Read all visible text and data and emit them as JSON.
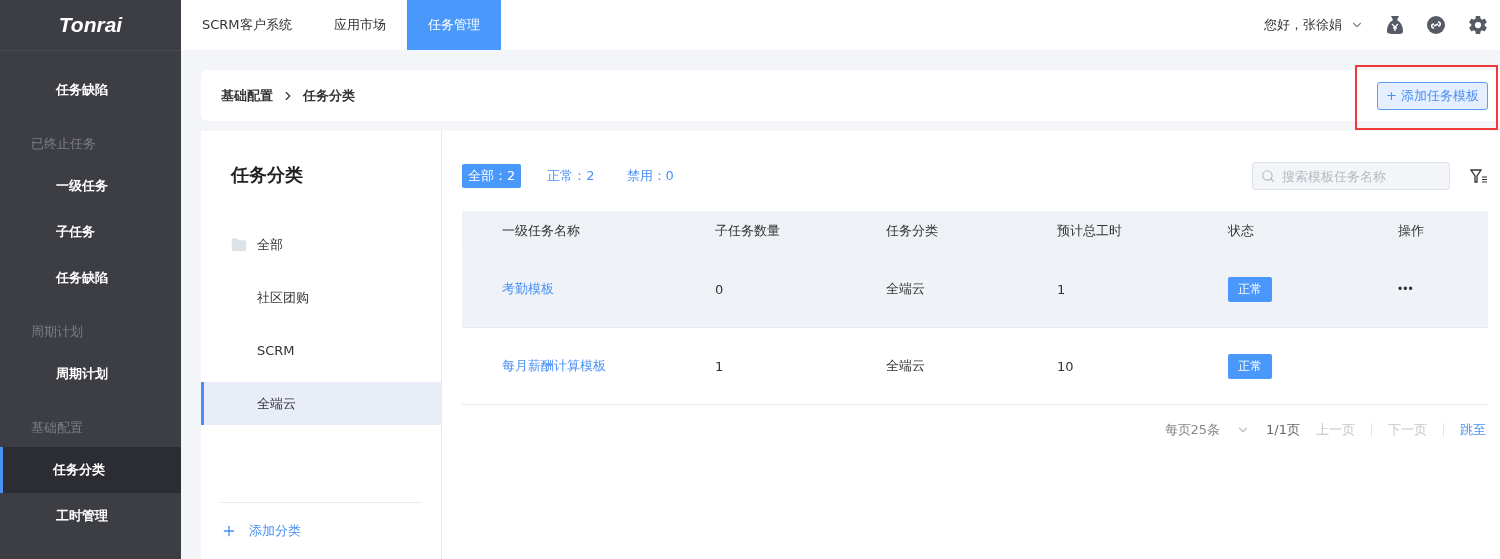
{
  "logo": "Tonrai",
  "top_nav": [
    {
      "label": "SCRM客户系统",
      "selected": false
    },
    {
      "label": "应用市场",
      "selected": false
    },
    {
      "label": "任务管理",
      "selected": true
    }
  ],
  "user": {
    "greeting": "您好，张徐娟"
  },
  "sidebar": {
    "groups": [
      {
        "items": [
          {
            "label": "任务缺陷",
            "selected": false
          }
        ]
      },
      {
        "title": "已终止任务",
        "items": [
          {
            "label": "一级任务",
            "selected": false
          },
          {
            "label": "子任务",
            "selected": false
          },
          {
            "label": "任务缺陷",
            "selected": false
          }
        ]
      },
      {
        "title": "周期计划",
        "items": [
          {
            "label": "周期计划",
            "selected": false
          }
        ]
      },
      {
        "title": "基础配置",
        "items": [
          {
            "label": "任务分类",
            "selected": true
          },
          {
            "label": "工时管理",
            "selected": false
          }
        ]
      }
    ]
  },
  "breadcrumb": [
    "基础配置",
    "任务分类"
  ],
  "add_template_button": {
    "label": "+ 添加任务模板",
    "highlighted": true
  },
  "category_panel": {
    "title": "任务分类",
    "items": [
      {
        "label": "全部",
        "kind": "folder",
        "selected": false
      },
      {
        "label": "社区团购",
        "kind": "plain",
        "selected": false
      },
      {
        "label": "SCRM",
        "kind": "plain",
        "selected": false
      },
      {
        "label": "全端云",
        "kind": "plain",
        "selected": true
      }
    ],
    "add_button": "添加分类"
  },
  "filters": [
    {
      "label": "全部：2",
      "selected": true
    },
    {
      "label": "正常：2",
      "selected": false
    },
    {
      "label": "禁用：0",
      "selected": false
    }
  ],
  "search": {
    "placeholder": "搜索模板任务名称"
  },
  "table": {
    "columns": [
      "一级任务名称",
      "子任务数量",
      "任务分类",
      "预计总工时",
      "状态",
      "操作"
    ],
    "rows": [
      {
        "name": "考勤模板",
        "subtasks": "0",
        "category": "全端云",
        "hours": "1",
        "status": "正常",
        "actions": "•••",
        "selected": true
      },
      {
        "name": "每月薪酬计算模板",
        "subtasks": "1",
        "category": "全端云",
        "hours": "10",
        "status": "正常",
        "selected": false
      }
    ]
  },
  "pagination": {
    "page_size": "每页25条",
    "pages": "1/1页",
    "prev": "上一页",
    "next": "下一页",
    "jump": "跳至"
  }
}
